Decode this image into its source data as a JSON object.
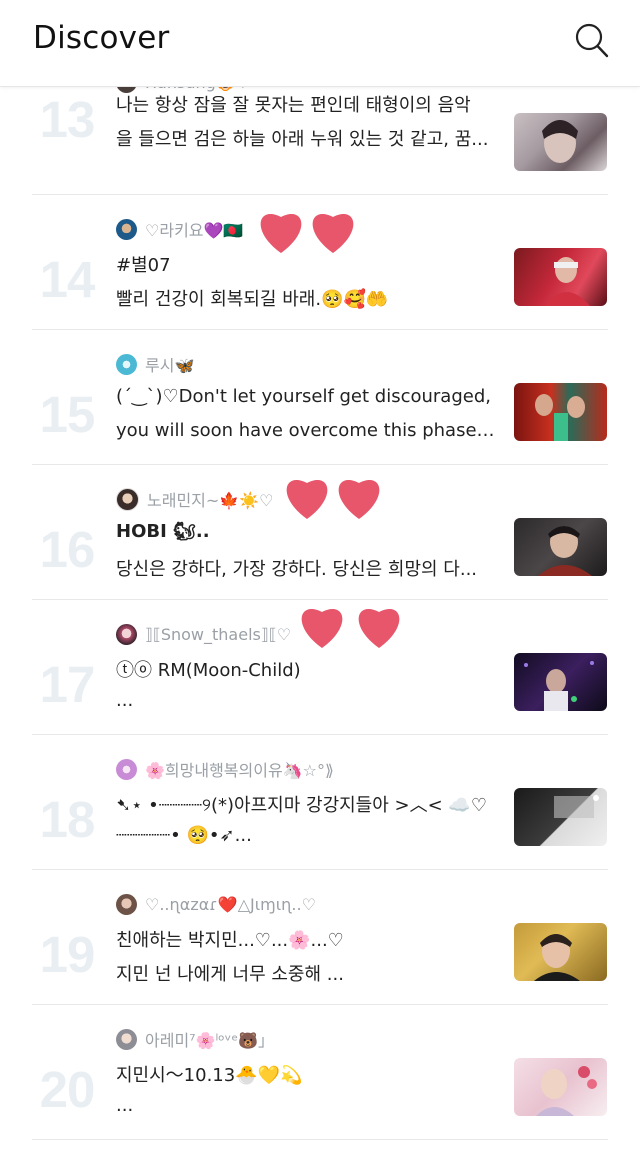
{
  "header": {
    "title": "Discover"
  },
  "items": [
    {
      "rank": "13",
      "author": "Hansung🐯♡",
      "line1": "나는 항상 잠을 잘 못자는 편인데 태형이의 음악",
      "line2": "을 들으면 검은 하늘 아래 누워 있는 것 같고, 꿈..."
    },
    {
      "rank": "14",
      "author": "♡라키요💜🇧🇩",
      "line1": "#별07",
      "line2": "빨리 건강이 회복되길 바래.🥺🥰🤲"
    },
    {
      "rank": "15",
      "author": "루시🦋",
      "line1": "(ˊ‿ˋ)♡Don't let yourself get discouraged,",
      "line2": "you will soon have overcome this phase a..."
    },
    {
      "rank": "16",
      "author": "노래민지~🍁☀️♡",
      "line1": "HOBI 🐿..",
      "line2": "당신은 강하다, 가장 강하다. 당신은 희망의 다..."
    },
    {
      "rank": "17",
      "author": "⟧⟦Snow_thaels⟧⟦♡",
      "line1": "ⓣⓞ  RM(Moon-Child)",
      "line2": "..."
    },
    {
      "rank": "18",
      "author": "🌸희망내행복의이유🦄☆°⟫",
      "line1": "➷⋆ •┈┈┈┈୨(*)아프지마 강강지들아 >︿< ☁️♡",
      "line2": "┈┈┈┈┈• 🥺•➶..."
    },
    {
      "rank": "19",
      "author": "♡..ɳαzαɾ❤️△Jιɱιɳ..♡",
      "line1": "친애하는 박지민...♡...🌸...♡",
      "line2": "지민 넌 나에게 너무 소중해 ..."
    },
    {
      "rank": "20",
      "author": "아레미⁷🌸ˡᵒᵛᵉ🐻」",
      "line1": "지민시〜10.13🐣💛💫",
      "line2": "..."
    }
  ],
  "colors": {
    "rank": "#e9eef3",
    "author": "#9aa0a6",
    "text": "#222222",
    "heart": "#e8566c",
    "separator": "#e8e8e8"
  }
}
